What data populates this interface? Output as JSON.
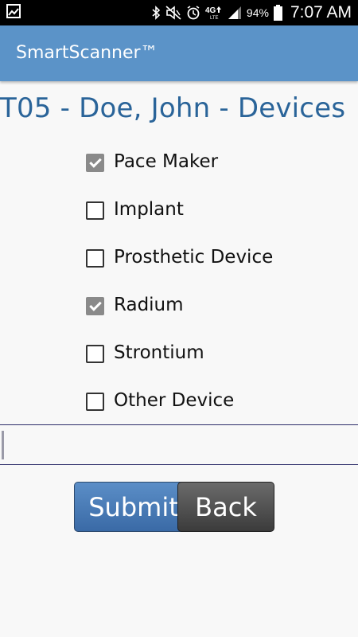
{
  "status_bar": {
    "battery_percent": "94%",
    "time": "7:07 AM",
    "network": "4G LTE",
    "icons": [
      "gallery-icon",
      "bluetooth-icon",
      "mute-icon",
      "alarm-icon",
      "network-icon",
      "signal-icon",
      "battery-icon"
    ]
  },
  "app_bar": {
    "title": "SmartScanner™"
  },
  "page": {
    "title": "T05 - Doe, John - Devices"
  },
  "devices": [
    {
      "label": "Pace Maker",
      "checked": true
    },
    {
      "label": "Implant",
      "checked": false
    },
    {
      "label": "Prosthetic Device",
      "checked": false
    },
    {
      "label": "Radium",
      "checked": true
    },
    {
      "label": "Strontium",
      "checked": false
    },
    {
      "label": "Other Device",
      "checked": false
    }
  ],
  "text_field": {
    "value": ""
  },
  "buttons": {
    "submit_label": "Submit",
    "back_label": "Back"
  },
  "colors": {
    "app_bar": "#5b93c8",
    "title_text": "#2a6499",
    "submit_button": "#4a7cb8",
    "back_button": "#555555"
  }
}
